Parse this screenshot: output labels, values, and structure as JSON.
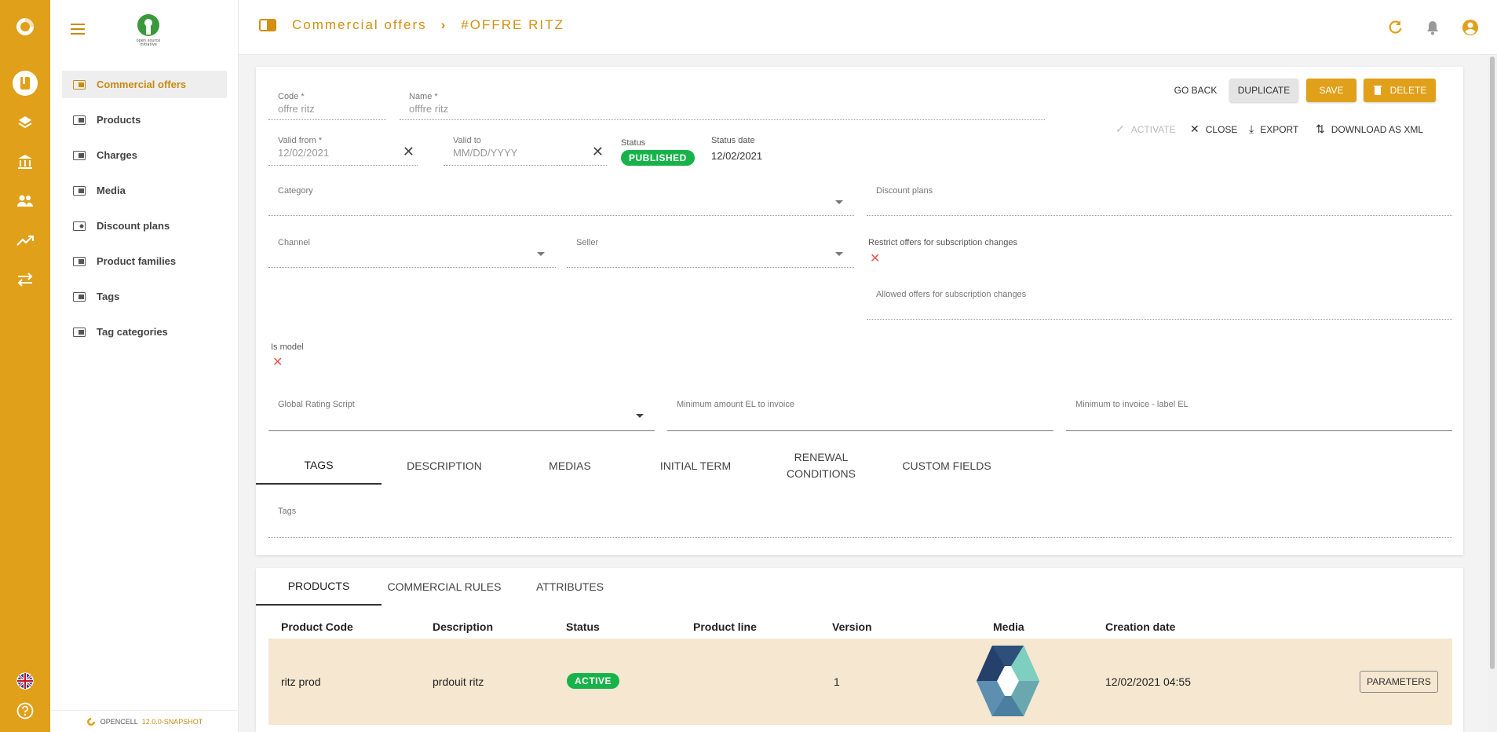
{
  "rail": {
    "items": [
      "logo-icon",
      "offers-icon",
      "layers-icon",
      "bank-icon",
      "people-icon",
      "trend-icon",
      "transfer-icon"
    ],
    "bottom": [
      "flag-uk-icon",
      "help-icon"
    ]
  },
  "sidebar": {
    "items": [
      {
        "label": "Commercial offers",
        "active": true
      },
      {
        "label": "Products"
      },
      {
        "label": "Charges"
      },
      {
        "label": "Media"
      },
      {
        "label": "Discount plans"
      },
      {
        "label": "Product families"
      },
      {
        "label": "Tags"
      },
      {
        "label": "Tag categories"
      }
    ],
    "version_prefix": "OPENCELL",
    "version": "12.0.0-SNAPSHOT"
  },
  "topbar": {
    "crumb_root": "Commercial offers",
    "crumb_current": "#OFFRE RITZ"
  },
  "form": {
    "code_label": "Code *",
    "code_value": "offre ritz",
    "name_label": "Name *",
    "name_value": "offfre ritz",
    "valid_from_label": "Valid from *",
    "valid_from_value": "12/02/2021",
    "valid_to_label": "Valid to",
    "valid_to_placeholder": "MM/DD/YYYY",
    "status_label": "Status",
    "status_value": "PUBLISHED",
    "status_date_label": "Status date",
    "status_date_value": "12/02/2021",
    "category_label": "Category",
    "discount_plans_label": "Discount plans",
    "channel_label": "Channel",
    "seller_label": "Seller",
    "restrict_label": "Restrict offers for subscription changes",
    "allowed_label": "Allowed offers for subscription changes",
    "is_model_label": "Is model",
    "rating_script_label": "Global Rating Script",
    "min_amount_label": "Minimum amount EL to invoice",
    "min_label_label": "Minimum to invoice - label EL",
    "tags_label": "Tags"
  },
  "actions": {
    "go_back": "GO BACK",
    "duplicate": "DUPLICATE",
    "save": "SAVE",
    "delete": "DELETE",
    "activate": "ACTIVATE",
    "close": "CLOSE",
    "export": "EXPORT",
    "download": "DOWNLOAD AS XML"
  },
  "tabs": [
    "TAGS",
    "DESCRIPTION",
    "MEDIAS",
    "INITIAL TERM",
    "RENEWAL CONDITIONS",
    "CUSTOM FIELDS"
  ],
  "bottom_tabs": [
    "PRODUCTS",
    "COMMERCIAL RULES",
    "ATTRIBUTES"
  ],
  "table": {
    "headers": [
      "Product Code",
      "Description",
      "Status",
      "Product line",
      "Version",
      "Media",
      "Creation date"
    ],
    "rows": [
      {
        "code": "ritz prod",
        "description": "prdouit ritz",
        "status": "ACTIVE",
        "product_line": "",
        "version": "1",
        "creation_date": "12/02/2021 04:55",
        "action": "PARAMETERS"
      }
    ]
  },
  "colors": {
    "accent": "#e0a01a",
    "success": "#17b34a",
    "row_highlight": "#f5e7d0"
  }
}
